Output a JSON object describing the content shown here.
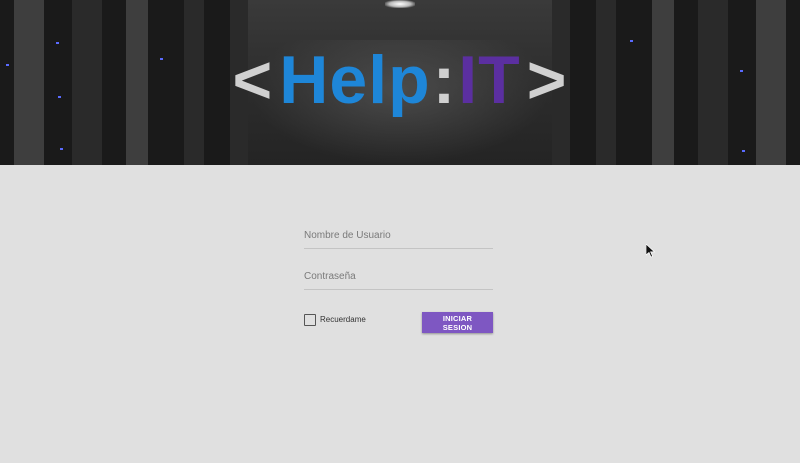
{
  "header": {
    "logo": {
      "open_bracket": "<",
      "word_help": "Help",
      "colon": ":",
      "word_it": "IT",
      "close_bracket": ">",
      "colors": {
        "help": "#1e86d8",
        "it": "#5b2fa0",
        "brackets": "#d0d0d0"
      }
    },
    "background": "server-room-photo"
  },
  "login": {
    "username_placeholder": "Nombre de Usuario",
    "username_value": "",
    "password_placeholder": "Contraseña",
    "password_value": "",
    "remember_label": "Recuerdame",
    "remember_checked": false,
    "submit_label": "INICIAR SESION",
    "accent_color": "#7e57c2"
  },
  "icons": {
    "cursor": "mouse-pointer-icon"
  }
}
